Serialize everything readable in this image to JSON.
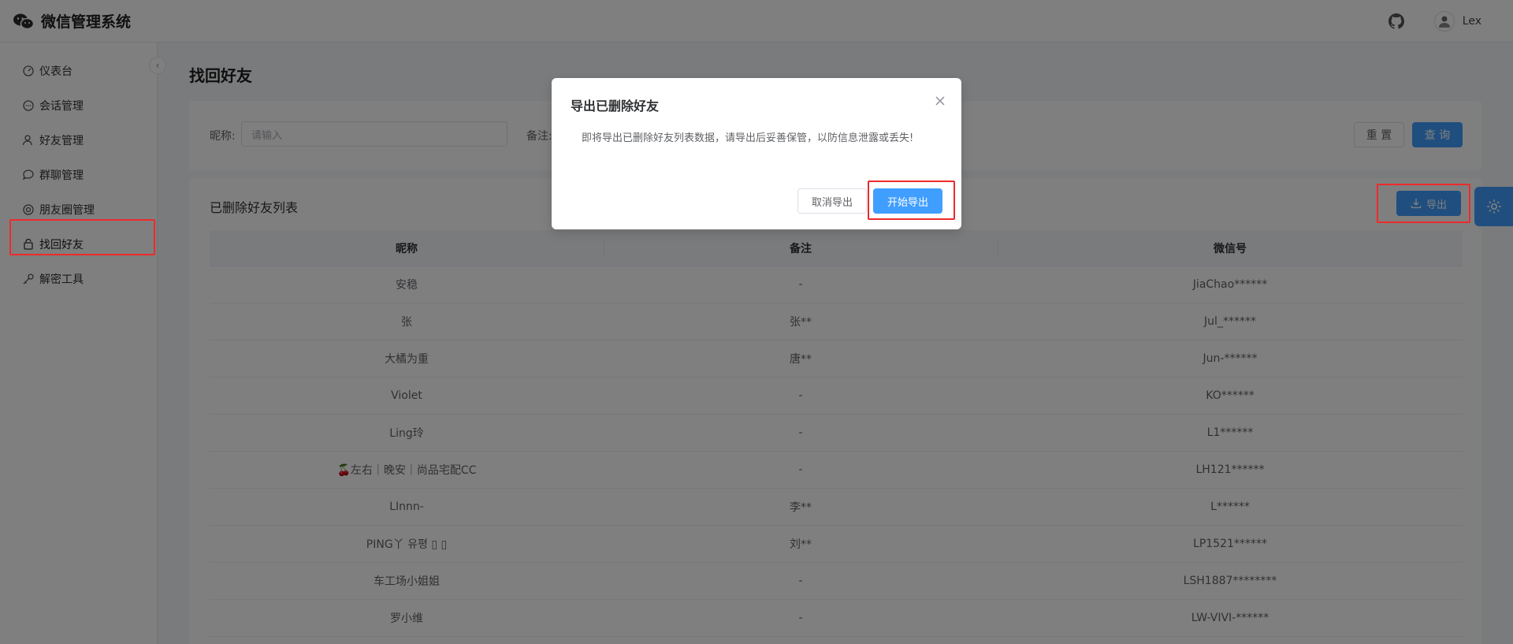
{
  "app": {
    "title": "微信管理系统",
    "user": "Lex"
  },
  "sidebar": {
    "items": [
      {
        "label": "仪表台",
        "icon": "dashboard-icon"
      },
      {
        "label": "会话管理",
        "icon": "chat-icon"
      },
      {
        "label": "好友管理",
        "icon": "user-icon"
      },
      {
        "label": "群聊管理",
        "icon": "group-chat-icon"
      },
      {
        "label": "朋友圈管理",
        "icon": "moments-icon"
      },
      {
        "label": "找回好友",
        "icon": "recover-icon"
      },
      {
        "label": "解密工具",
        "icon": "key-icon"
      }
    ],
    "active": "找回好友"
  },
  "page": {
    "title": "找回好友"
  },
  "search": {
    "nickname_label": "昵称:",
    "nickname_placeholder": "请输入",
    "remark_label": "备注:",
    "reset_label": "重 置",
    "query_label": "查 询"
  },
  "table": {
    "title": "已删除好友列表",
    "export_label": "导出",
    "columns": [
      "昵称",
      "备注",
      "微信号"
    ],
    "rows": [
      [
        "安稳",
        "-",
        "JiaChao******"
      ],
      [
        "张",
        "张**",
        "Jul_******"
      ],
      [
        "大橘为重",
        "唐**",
        "Jun-******"
      ],
      [
        "Violet",
        "-",
        "KO******"
      ],
      [
        "Ling玲",
        "-",
        "L1******"
      ],
      [
        "🍒左右｜晚安｜尚品宅配CC",
        "-",
        "LH121******"
      ],
      [
        "LInnn-",
        "李**",
        "L******"
      ],
      [
        "PING丫 유평 ▯ ▯",
        "刘**",
        "LP1521******"
      ],
      [
        "车工场小姐姐",
        "-",
        "LSH1887********"
      ],
      [
        "罗小维",
        "-",
        "LW-VIVI-******"
      ]
    ]
  },
  "dialog": {
    "title": "导出已删除好友",
    "message": "即将导出已删除好友列表数据，请导出后妥善保管，以防信息泄露或丢失!",
    "cancel_label": "取消导出",
    "confirm_label": "开始导出"
  },
  "colors": {
    "primary": "#409eff",
    "highlight": "#ee2a2a"
  }
}
